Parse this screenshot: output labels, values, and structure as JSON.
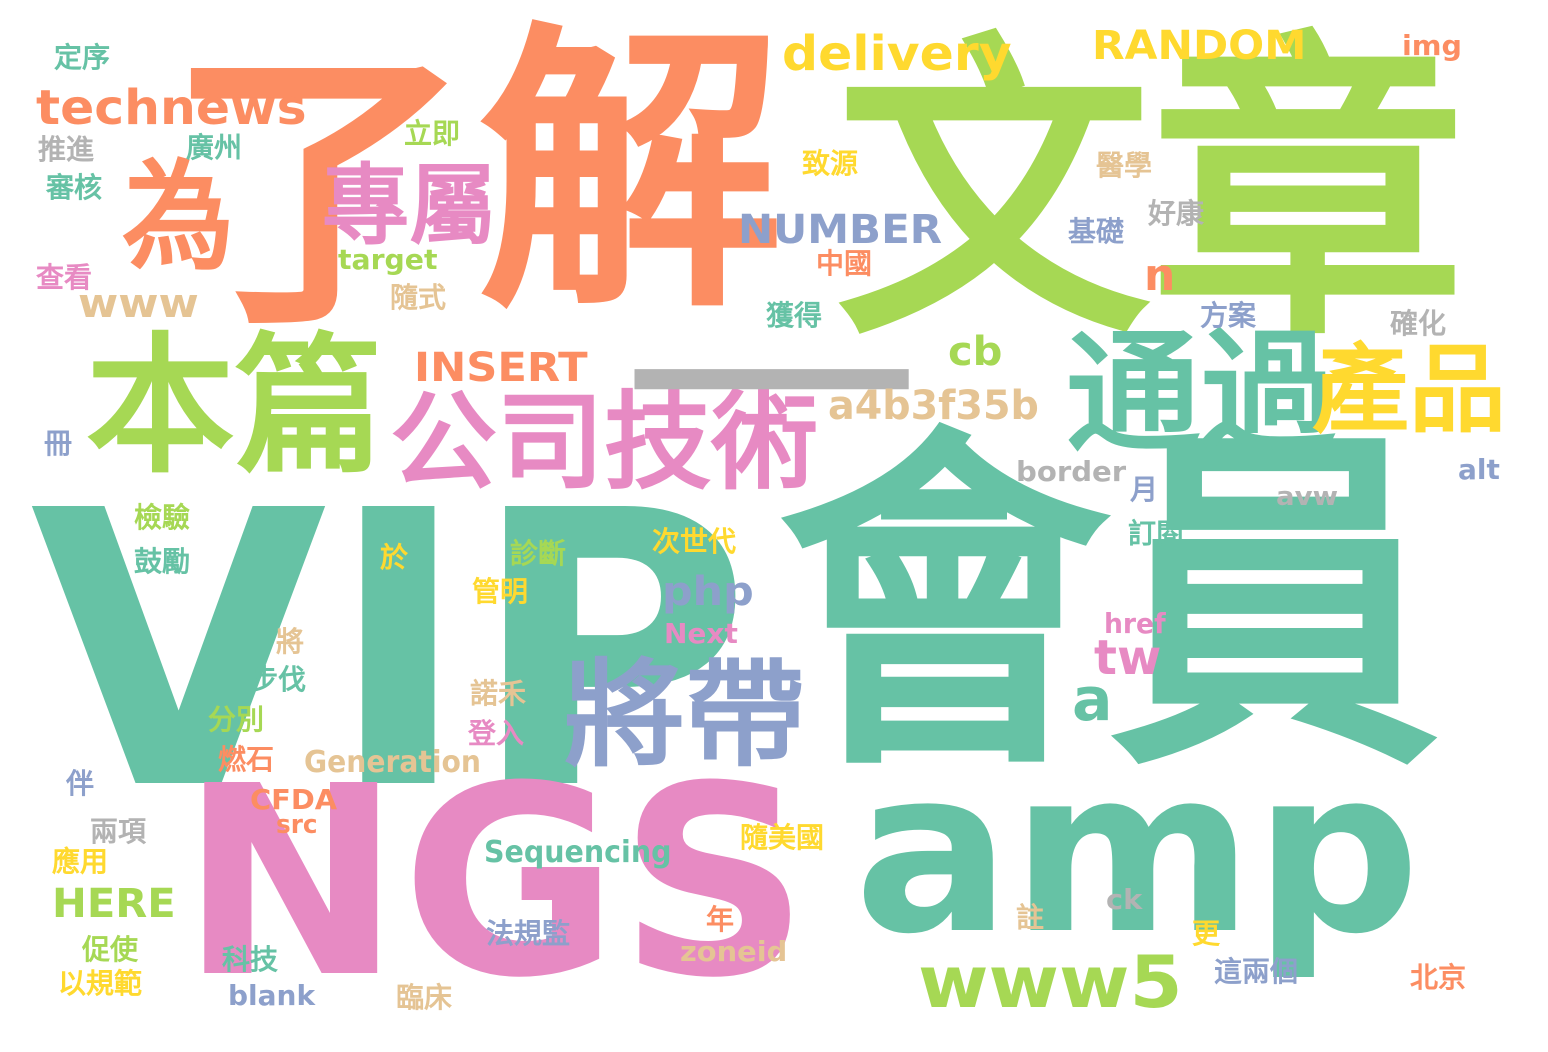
{
  "palette": {
    "teal": "#66c2a5",
    "orange": "#fc8d62",
    "blue": "#8da0cb",
    "pink": "#e78ac3",
    "green": "#a6d854",
    "yellow": "#ffd92f",
    "tan": "#e5c494",
    "gray": "#b3b3b3"
  },
  "words": [
    {
      "text": "VIP",
      "color": "#66c2a5"
    },
    {
      "text": "會員",
      "color": "#66c2a5"
    },
    {
      "text": "文章",
      "color": "#a6d854"
    },
    {
      "text": "解",
      "color": "#fc8d62"
    },
    {
      "text": "了",
      "color": "#fc8d62"
    },
    {
      "text": "amp",
      "color": "#66c2a5"
    },
    {
      "text": "NGS",
      "color": "#e78ac3"
    },
    {
      "text": "本篇",
      "color": "#a6d854"
    },
    {
      "text": "為",
      "color": "#fc8d62"
    },
    {
      "text": "通過",
      "color": "#66c2a5"
    },
    {
      "text": "產品",
      "color": "#ffd92f"
    },
    {
      "text": "將帶",
      "color": "#8da0cb"
    },
    {
      "text": "公司技術",
      "color": "#e78ac3"
    },
    {
      "text": "專屬",
      "color": "#e78ac3"
    },
    {
      "text": "—",
      "color": "#b3b3b3"
    },
    {
      "text": "www5",
      "color": "#a6d854"
    },
    {
      "text": "technews",
      "color": "#fc8d62"
    },
    {
      "text": "delivery",
      "color": "#ffd92f"
    },
    {
      "text": "RANDOM",
      "color": "#ffd92f"
    },
    {
      "text": "NUMBER",
      "color": "#8da0cb"
    },
    {
      "text": "INSERT",
      "color": "#fc8d62"
    },
    {
      "text": "a4b3f35b",
      "color": "#e5c494"
    },
    {
      "text": "www",
      "color": "#e5c494"
    },
    {
      "text": "php",
      "color": "#8da0cb"
    },
    {
      "text": "HERE",
      "color": "#a6d854"
    },
    {
      "text": "Sequencing",
      "color": "#66c2a5"
    },
    {
      "text": "Generation",
      "color": "#e5c494"
    },
    {
      "text": "CFDA",
      "color": "#fc8d62"
    },
    {
      "text": "border",
      "color": "#b3b3b3"
    },
    {
      "text": "avw",
      "color": "#b3b3b3"
    },
    {
      "text": "target",
      "color": "#a6d854"
    },
    {
      "text": "zoneid",
      "color": "#e5c494"
    },
    {
      "text": "blank",
      "color": "#8da0cb"
    },
    {
      "text": "Next",
      "color": "#e78ac3"
    },
    {
      "text": "href",
      "color": "#e78ac3"
    },
    {
      "text": "src",
      "color": "#fc8d62"
    },
    {
      "text": "img",
      "color": "#fc8d62"
    },
    {
      "text": "alt",
      "color": "#8da0cb"
    },
    {
      "text": "ck",
      "color": "#b3b3b3"
    },
    {
      "text": "cb",
      "color": "#a6d854"
    },
    {
      "text": "tw",
      "color": "#e78ac3"
    },
    {
      "text": "a",
      "color": "#66c2a5"
    },
    {
      "text": "n",
      "color": "#fc8d62"
    },
    {
      "text": "定序",
      "color": "#66c2a5"
    },
    {
      "text": "推進",
      "color": "#b3b3b3"
    },
    {
      "text": "廣州",
      "color": "#66c2a5"
    },
    {
      "text": "審核",
      "color": "#66c2a5"
    },
    {
      "text": "查看",
      "color": "#e78ac3"
    },
    {
      "text": "立即",
      "color": "#a6d854"
    },
    {
      "text": "致源",
      "color": "#ffd92f"
    },
    {
      "text": "中國",
      "color": "#fc8d62"
    },
    {
      "text": "隨式",
      "color": "#e5c494"
    },
    {
      "text": "獲得",
      "color": "#66c2a5"
    },
    {
      "text": "醫學",
      "color": "#e5c494"
    },
    {
      "text": "好康",
      "color": "#b3b3b3"
    },
    {
      "text": "基礎",
      "color": "#8da0cb"
    },
    {
      "text": "方案",
      "color": "#8da0cb"
    },
    {
      "text": "確化",
      "color": "#b3b3b3"
    },
    {
      "text": "冊",
      "color": "#8da0cb"
    },
    {
      "text": "月",
      "color": "#8da0cb"
    },
    {
      "text": "訂閱",
      "color": "#66c2a5"
    },
    {
      "text": "檢驗",
      "color": "#a6d854"
    },
    {
      "text": "鼓勵",
      "color": "#66c2a5"
    },
    {
      "text": "次世代",
      "color": "#ffd92f"
    },
    {
      "text": "於",
      "color": "#ffd92f"
    },
    {
      "text": "診斷",
      "color": "#a6d854"
    },
    {
      "text": "管明",
      "color": "#ffd92f"
    },
    {
      "text": "將",
      "color": "#e5c494"
    },
    {
      "text": "步伐",
      "color": "#66c2a5"
    },
    {
      "text": "諾禾",
      "color": "#e5c494"
    },
    {
      "text": "分別",
      "color": "#a6d854"
    },
    {
      "text": "登入",
      "color": "#e78ac3"
    },
    {
      "text": "燃石",
      "color": "#fc8d62"
    },
    {
      "text": "伴",
      "color": "#8da0cb"
    },
    {
      "text": "兩項",
      "color": "#b3b3b3"
    },
    {
      "text": "隨美國",
      "color": "#ffd92f"
    },
    {
      "text": "應用",
      "color": "#ffd92f"
    },
    {
      "text": "註",
      "color": "#e5c494"
    },
    {
      "text": "更",
      "color": "#ffd92f"
    },
    {
      "text": "年",
      "color": "#fc8d62"
    },
    {
      "text": "法規監",
      "color": "#8da0cb"
    },
    {
      "text": "促使",
      "color": "#a6d854"
    },
    {
      "text": "科技",
      "color": "#66c2a5"
    },
    {
      "text": "以規範",
      "color": "#ffd92f"
    },
    {
      "text": "這兩個",
      "color": "#8da0cb"
    },
    {
      "text": "北京",
      "color": "#fc8d62"
    },
    {
      "text": "臨床",
      "color": "#e5c494"
    }
  ]
}
